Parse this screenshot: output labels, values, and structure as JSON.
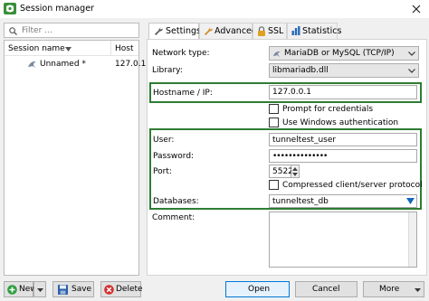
{
  "window": {
    "title": "Session manager"
  },
  "left": {
    "filter_placeholder": "Filter ...",
    "columns": {
      "name": "Session name",
      "host": "Host"
    },
    "sessions": [
      {
        "name": "Unnamed *",
        "host": "127.0.1"
      }
    ]
  },
  "tabs": [
    {
      "label": "Settings",
      "icon": "wrench-icon",
      "active": true
    },
    {
      "label": "Advanced",
      "icon": "wrench-icon",
      "active": false
    },
    {
      "label": "SSL",
      "icon": "lock-icon",
      "active": false
    },
    {
      "label": "Statistics",
      "icon": "bar-chart-icon",
      "active": false
    }
  ],
  "settings": {
    "network_type_label": "Network type:",
    "network_type_value": "MariaDB or MySQL (TCP/IP)",
    "library_label": "Library:",
    "library_value": "libmariadb.dll",
    "hostname_label": "Hostname / IP:",
    "hostname_value": "127.0.0.1",
    "prompt_credentials_label": "Prompt for credentials",
    "prompt_credentials_checked": false,
    "windows_auth_label": "Use Windows authentication",
    "windows_auth_checked": false,
    "user_label": "User:",
    "user_value": "tunneltest_user",
    "password_label": "Password:",
    "password_value": "••••••••••••••",
    "port_label": "Port:",
    "port_value": "5522",
    "compressed_label": "Compressed client/server protocol",
    "compressed_checked": false,
    "databases_label": "Databases:",
    "databases_value": "tunneltest_db",
    "comment_label": "Comment:",
    "comment_value": ""
  },
  "buttons": {
    "new": "New",
    "save": "Save",
    "delete": "Delete",
    "open": "Open",
    "cancel": "Cancel",
    "more": "More"
  },
  "colors": {
    "highlight_border": "#2e7d32",
    "new_icon": "#2e9e3e",
    "delete_icon": "#d32f2f",
    "save_icon": "#2a5ea8",
    "databases_arrow": "#1565c0"
  }
}
